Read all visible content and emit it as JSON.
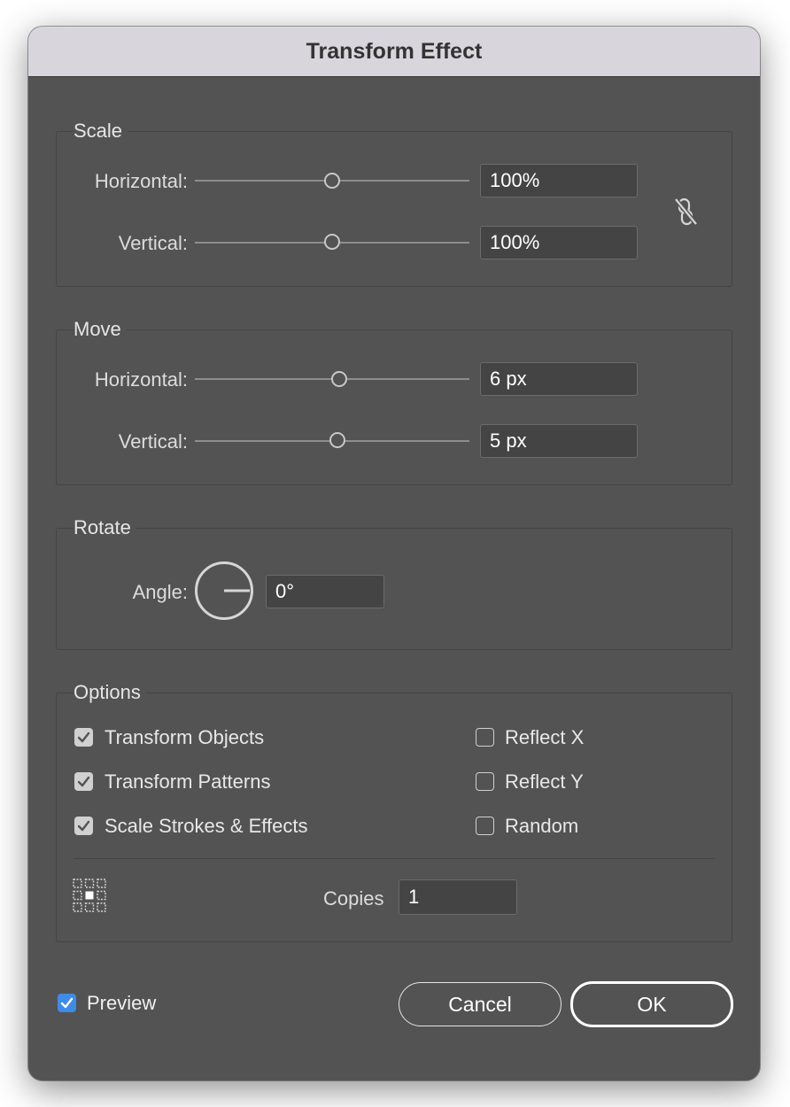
{
  "dialog": {
    "title": "Transform Effect"
  },
  "scale": {
    "label": "Scale",
    "horizontal_label": "Horizontal:",
    "horizontal_value": "100%",
    "vertical_label": "Vertical:",
    "vertical_value": "100%",
    "constrain_icon": "unlinked-chain-icon"
  },
  "move": {
    "label": "Move",
    "horizontal_label": "Horizontal:",
    "horizontal_value": "6 px",
    "vertical_label": "Vertical:",
    "vertical_value": "5 px"
  },
  "rotate": {
    "label": "Rotate",
    "angle_label": "Angle:",
    "angle_value": "0°"
  },
  "options": {
    "label": "Options",
    "transform_objects": {
      "label": "Transform Objects",
      "checked": true
    },
    "transform_patterns": {
      "label": "Transform Patterns",
      "checked": true
    },
    "scale_strokes": {
      "label": "Scale Strokes & Effects",
      "checked": true
    },
    "reflect_x": {
      "label": "Reflect X",
      "checked": false
    },
    "reflect_y": {
      "label": "Reflect Y",
      "checked": false
    },
    "random": {
      "label": "Random",
      "checked": false
    },
    "reference_point_icon": "reference-point-grid-icon",
    "copies_label": "Copies",
    "copies_value": "1"
  },
  "footer": {
    "preview_label": "Preview",
    "preview_checked": true,
    "cancel_label": "Cancel",
    "ok_label": "OK"
  },
  "colors": {
    "panel_bg": "#535353",
    "titlebar_bg": "#d8d6dc",
    "accent_blue": "#3f8be8"
  }
}
